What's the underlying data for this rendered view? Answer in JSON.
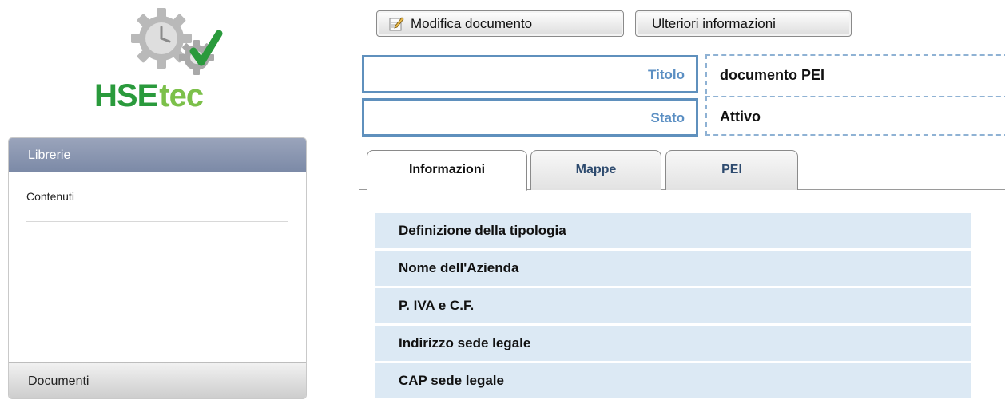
{
  "logo": {
    "text_primary": "HSE",
    "text_secondary": "tec",
    "colors": {
      "gear": "#b9b9b9",
      "check": "#2a9a3c",
      "hse": "#2a9a3c",
      "tec": "#7cc04a"
    }
  },
  "sidebar": {
    "header": "Librerie",
    "items": [
      {
        "label": "Contenuti"
      }
    ],
    "footer": "Documenti"
  },
  "toolbar": {
    "edit_label": "Modifica documento",
    "info_label": "Ulteriori informazioni"
  },
  "document": {
    "title_label": "Titolo",
    "title_value": "documento PEI",
    "status_label": "Stato",
    "status_value": "Attivo"
  },
  "tabs": [
    {
      "label": "Informazioni",
      "active": true
    },
    {
      "label": "Mappe",
      "active": false
    },
    {
      "label": "PEI",
      "active": false
    }
  ],
  "fields": [
    "Definizione della tipologia",
    "Nome dell'Azienda",
    "P. IVA e C.F.",
    "Indirizzo sede legale",
    "CAP sede legale"
  ],
  "colors": {
    "accent_blue": "#5b8fc3",
    "row_bg": "#dce9f4",
    "sidebar_header": "#7c8aa7"
  }
}
